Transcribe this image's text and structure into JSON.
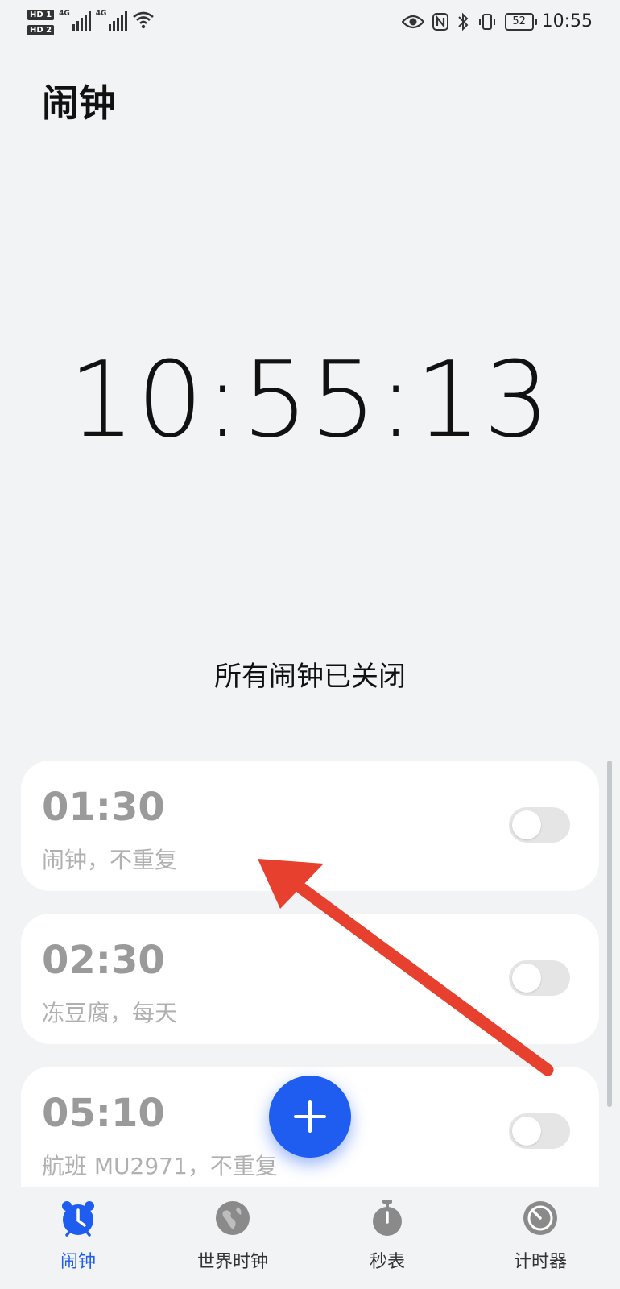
{
  "status_bar": {
    "sim1": "HD 1",
    "sim2": "HD 2",
    "net1": "4G",
    "net2": "4G",
    "battery": "52",
    "time": "10:55"
  },
  "header": {
    "title": "闹钟"
  },
  "clock": {
    "time": "10:55:13"
  },
  "status_message": "所有闹钟已关闭",
  "alarms": [
    {
      "time": "01:30",
      "subtitle": "闹钟，不重复",
      "enabled": false
    },
    {
      "time": "02:30",
      "subtitle": "冻豆腐，每天",
      "enabled": false
    },
    {
      "time": "05:10",
      "subtitle": "航班 MU2971，不重复",
      "enabled": false
    }
  ],
  "tabs": [
    {
      "label": "闹钟",
      "icon": "alarm-clock-icon",
      "active": true
    },
    {
      "label": "世界时钟",
      "icon": "globe-icon",
      "active": false
    },
    {
      "label": "秒表",
      "icon": "stopwatch-icon",
      "active": false
    },
    {
      "label": "计时器",
      "icon": "timer-icon",
      "active": false
    }
  ],
  "colors": {
    "accent": "#1f5cf0",
    "background": "#f1f3f5",
    "annotation_arrow": "#e8402f"
  }
}
